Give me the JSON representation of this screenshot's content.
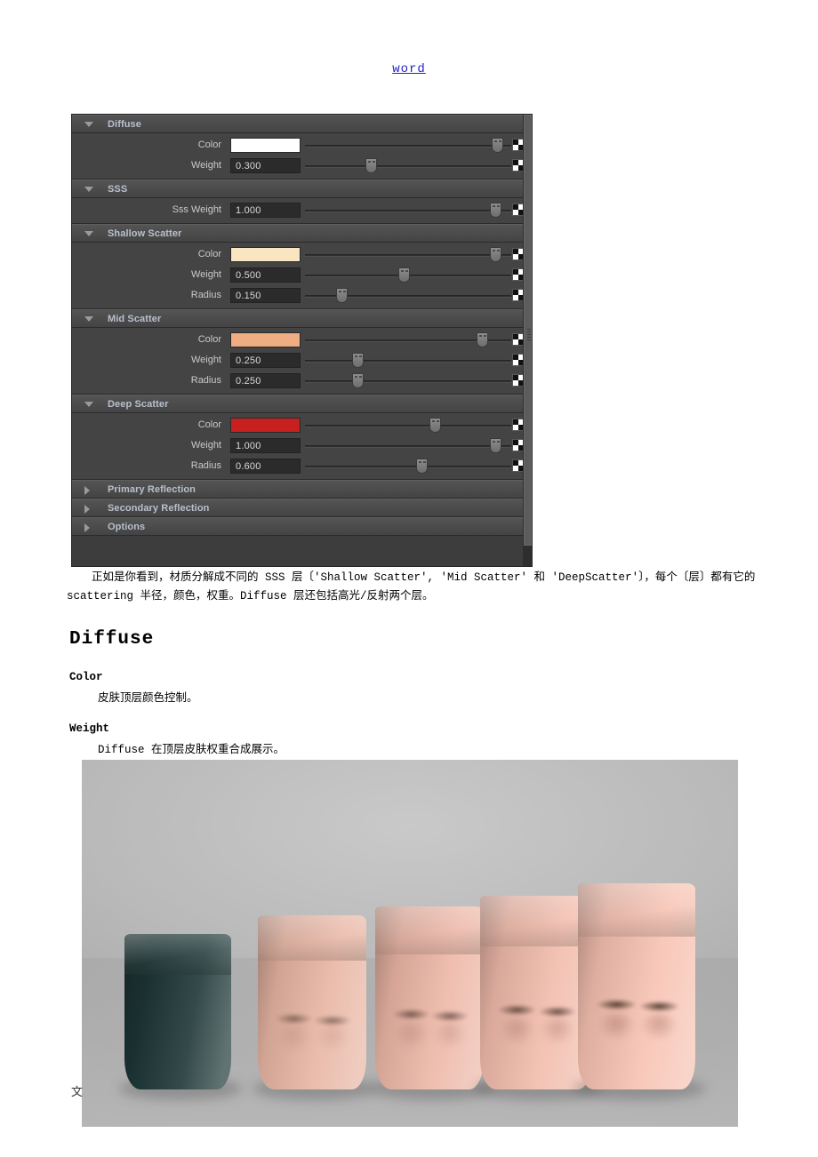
{
  "top_link": {
    "label": "word"
  },
  "panel": {
    "sections": [
      {
        "title": "Diffuse",
        "expanded": true,
        "arrow_icon": "triangle-down-icon",
        "rows": [
          {
            "label": "Color",
            "kind": "color",
            "value": "",
            "color": "#ffffff",
            "slider_pct": 96,
            "map_icon": "checker-map-icon"
          },
          {
            "label": "Weight",
            "kind": "number",
            "value": "0.300",
            "slider_pct": 31,
            "map_icon": "checker-map-icon"
          }
        ]
      },
      {
        "title": "SSS",
        "expanded": true,
        "arrow_icon": "triangle-down-icon",
        "rows": [
          {
            "label": "Sss Weight",
            "kind": "number",
            "value": "1.000",
            "slider_pct": 95,
            "map_icon": "checker-map-icon"
          }
        ]
      },
      {
        "title": "Shallow Scatter",
        "expanded": true,
        "arrow_icon": "triangle-down-icon",
        "rows": [
          {
            "label": "Color",
            "kind": "color",
            "value": "",
            "color": "#fae5c3",
            "slider_pct": 95,
            "map_icon": "checker-map-icon"
          },
          {
            "label": "Weight",
            "kind": "number",
            "value": "0.500",
            "slider_pct": 48,
            "map_icon": "checker-map-icon"
          },
          {
            "label": "Radius",
            "kind": "number",
            "value": "0.150",
            "slider_pct": 16,
            "map_icon": "checker-map-icon"
          }
        ]
      },
      {
        "title": "Mid Scatter",
        "expanded": true,
        "arrow_icon": "triangle-down-icon",
        "rows": [
          {
            "label": "Color",
            "kind": "color",
            "value": "",
            "color": "#f0ac83",
            "slider_pct": 88,
            "map_icon": "checker-map-icon"
          },
          {
            "label": "Weight",
            "kind": "number",
            "value": "0.250",
            "slider_pct": 24,
            "map_icon": "checker-map-icon"
          },
          {
            "label": "Radius",
            "kind": "number",
            "value": "0.250",
            "slider_pct": 24,
            "map_icon": "checker-map-icon"
          }
        ]
      },
      {
        "title": "Deep Scatter",
        "expanded": true,
        "arrow_icon": "triangle-down-icon",
        "rows": [
          {
            "label": "Color",
            "kind": "color",
            "value": "",
            "color": "#c8201f",
            "slider_pct": 64,
            "map_icon": "checker-map-icon"
          },
          {
            "label": "Weight",
            "kind": "number",
            "value": "1.000",
            "slider_pct": 95,
            "map_icon": "checker-map-icon"
          },
          {
            "label": "Radius",
            "kind": "number",
            "value": "0.600",
            "slider_pct": 57,
            "map_icon": "checker-map-icon"
          }
        ]
      },
      {
        "title": "Primary Reflection",
        "expanded": false,
        "arrow_icon": "triangle-right-icon",
        "rows": []
      },
      {
        "title": "Secondary Reflection",
        "expanded": false,
        "arrow_icon": "triangle-right-icon",
        "rows": []
      },
      {
        "title": "Options",
        "expanded": false,
        "arrow_icon": "triangle-right-icon",
        "rows": []
      }
    ]
  },
  "body": {
    "intro_paragraph": "正如是你看到，材质分解成不同的 SSS 层〔'Shallow Scatter', 'Mid Scatter' 和 'DeepScatter'〕，每个〔层〕都有它的 scattering 半径，颜色，权重。Diffuse 层还包括高光/反射两个层。",
    "heading_diffuse": "Diffuse",
    "prop_color_name": "Color",
    "prop_color_desc": "皮肤顶层颜色控制。",
    "prop_weight_name": "Weight",
    "prop_weight_desc": "Diffuse 在顶层皮肤权重合成展示。"
  },
  "render_image": {
    "alt": "skin-sss-weight-comparison-render",
    "background_color": "#b4b4b4",
    "heads": [
      {
        "name": "head-weight-0",
        "skin": "#1d3636"
      },
      {
        "name": "head-weight-1",
        "skin": "#e8b6a4"
      },
      {
        "name": "head-weight-2",
        "skin": "#edb7a7"
      },
      {
        "name": "head-weight-3",
        "skin": "#f2bcac"
      },
      {
        "name": "head-weight-4",
        "skin": "#f7c2b2"
      }
    ]
  },
  "footer": {
    "char": "文"
  }
}
